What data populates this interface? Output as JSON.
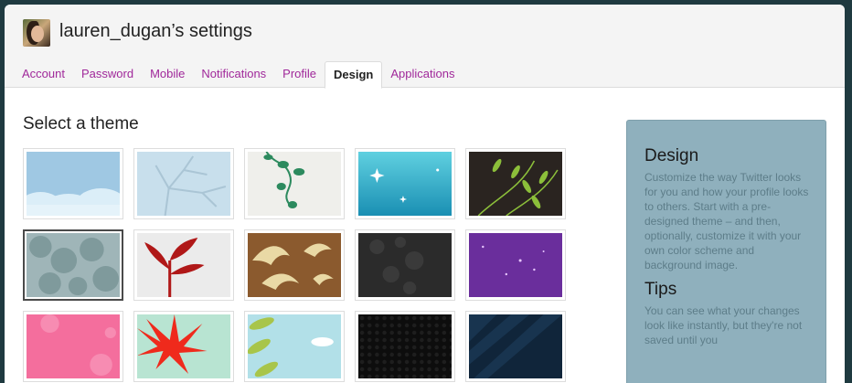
{
  "header": {
    "title": "lauren_dugan’s settings",
    "avatar_icon": "user-avatar"
  },
  "tabs": [
    {
      "label": "Account",
      "active": false
    },
    {
      "label": "Password",
      "active": false
    },
    {
      "label": "Mobile",
      "active": false
    },
    {
      "label": "Notifications",
      "active": false
    },
    {
      "label": "Profile",
      "active": false
    },
    {
      "label": "Design",
      "active": true
    },
    {
      "label": "Applications",
      "active": false
    }
  ],
  "main": {
    "section_title": "Select a theme",
    "themes": [
      {
        "name": "sky-clouds",
        "selected": false
      },
      {
        "name": "bare-tree",
        "selected": false
      },
      {
        "name": "green-vines",
        "selected": false
      },
      {
        "name": "blue-sparkles",
        "selected": false
      },
      {
        "name": "green-leaves-dark",
        "selected": false
      },
      {
        "name": "grey-foliage",
        "selected": true
      },
      {
        "name": "red-branch",
        "selected": false
      },
      {
        "name": "brown-birds",
        "selected": false
      },
      {
        "name": "dark-grey-pattern",
        "selected": false
      },
      {
        "name": "purple-sparkles",
        "selected": false
      },
      {
        "name": "pink-flowers",
        "selected": false
      },
      {
        "name": "red-flower-mint",
        "selected": false
      },
      {
        "name": "leaves-sky",
        "selected": false
      },
      {
        "name": "black-honeycomb",
        "selected": false
      },
      {
        "name": "navy-rays",
        "selected": false
      }
    ]
  },
  "sidebar": {
    "design_title": "Design",
    "design_text": "Customize the way Twitter looks for you and how your profile looks to others. Start with a pre-designed theme – and then, optionally, customize it with your own color scheme and background image.",
    "tips_title": "Tips",
    "tips_text": "You can see what your changes look like instantly, but they're not saved until you"
  },
  "colors": {
    "tab_link": "#a0289a",
    "sidebar_bg": "#8fb0bd",
    "sidebar_text": "#5d7d89"
  }
}
